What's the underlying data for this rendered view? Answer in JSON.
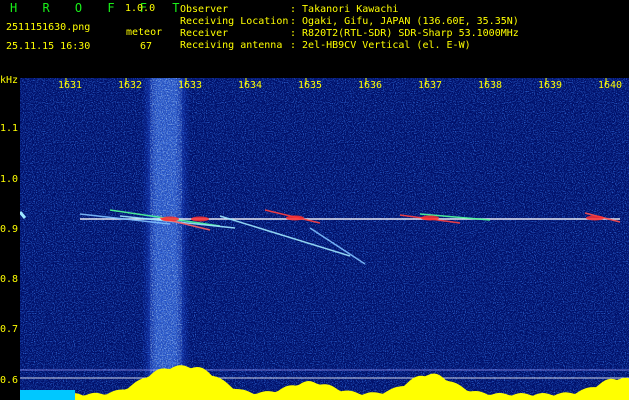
{
  "header": {
    "app_name": "H R O F F T",
    "version": "1.0.0",
    "filename": "2511151630.png",
    "datetime": "25.11.15 16:30",
    "meteor_label": "meteor",
    "meteor_count": "67"
  },
  "info": [
    {
      "key": "Observer",
      "value": ": Takanori Kawachi"
    },
    {
      "key": "Receiving Location",
      "value": ": Ogaki, Gifu, JAPAN (136.60E, 35.35N)"
    },
    {
      "key": "Receiver",
      "value": ": R820T2(RTL-SDR) SDR-Sharp 53.1000MHz"
    },
    {
      "key": "Receiving antenna",
      "value": ": 2el-HB9CV Vertical (el. E-W)"
    }
  ],
  "axes": {
    "y_unit": "kHz",
    "y_ticks": [
      "1.1",
      "1.0",
      "0.9",
      "0.8",
      "0.7",
      "0.6"
    ],
    "x_ticks": [
      "1631",
      "1632",
      "1633",
      "1634",
      "1635",
      "1636",
      "1637",
      "1638",
      "1639",
      "1640"
    ]
  },
  "colors": {
    "label": "#ffff00",
    "title": "#19f019",
    "background": "#000000",
    "spectrum_bg": "#00106a",
    "trace": "#ffffff",
    "meteor_echo": "#ff3030",
    "baseline_fill": "#ffff00"
  }
}
